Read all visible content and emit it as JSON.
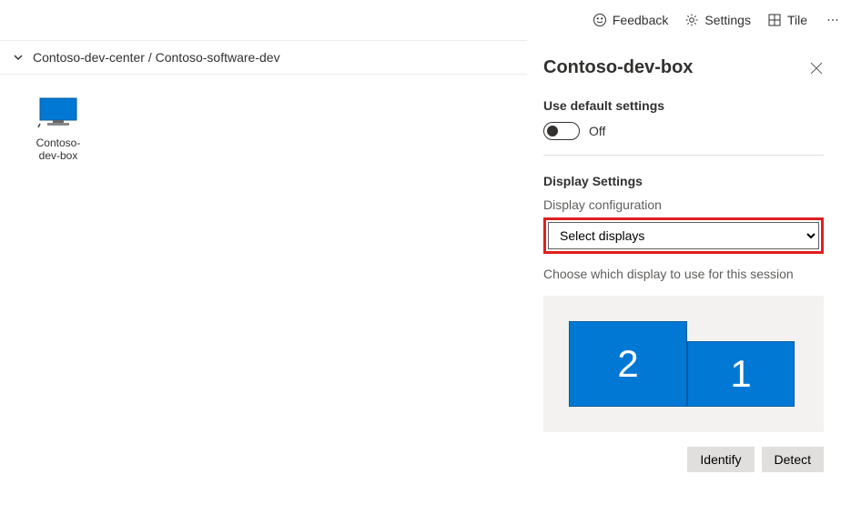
{
  "topbar": {
    "feedback": "Feedback",
    "settings": "Settings",
    "tile": "Tile"
  },
  "breadcrumb": "Contoso-dev-center / Contoso-software-dev",
  "tile": {
    "label": "Contoso-dev-box"
  },
  "panel": {
    "title": "Contoso-dev-box",
    "defaultSettingsHeading": "Use default settings",
    "toggleState": "Off",
    "displaySettingsHeading": "Display Settings",
    "displayConfigLabel": "Display configuration",
    "displayConfigValue": "Select displays",
    "helper": "Choose which display to use for this session",
    "displays": [
      {
        "id": "2"
      },
      {
        "id": "1"
      }
    ],
    "identifyBtn": "Identify",
    "detectBtn": "Detect"
  }
}
